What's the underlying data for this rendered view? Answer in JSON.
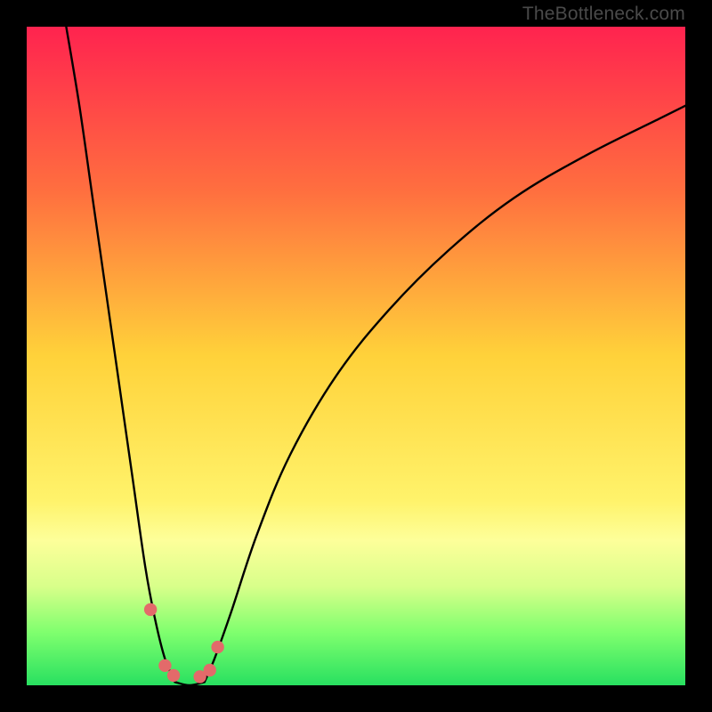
{
  "watermark": "TheBottleneck.com",
  "chart_data": {
    "type": "line",
    "title": "",
    "xlabel": "",
    "ylabel": "",
    "xlim": [
      0,
      100
    ],
    "ylim": [
      0,
      100
    ],
    "notes": "V-shaped bottleneck curve. Y-axis maps to background gradient: high=red (bottleneck), low=green (balanced). No numeric axes shown; x and y are relative 0–100.",
    "gradient_stops": [
      {
        "pct": 0,
        "color": "#ff234f"
      },
      {
        "pct": 25,
        "color": "#ff6f3f"
      },
      {
        "pct": 50,
        "color": "#ffd23a"
      },
      {
        "pct": 72,
        "color": "#fff36b"
      },
      {
        "pct": 78,
        "color": "#fdff9a"
      },
      {
        "pct": 85,
        "color": "#d8ff8a"
      },
      {
        "pct": 92,
        "color": "#7fff6e"
      },
      {
        "pct": 100,
        "color": "#28e060"
      }
    ],
    "series": [
      {
        "name": "left-branch",
        "x": [
          6,
          8,
          10,
          12,
          14,
          16,
          18,
          19.5,
          21,
          22.5
        ],
        "y": [
          100,
          88,
          74,
          60,
          46,
          32,
          18,
          10,
          4,
          0.5
        ]
      },
      {
        "name": "right-branch",
        "x": [
          27,
          28.5,
          31,
          35,
          40,
          47,
          55,
          64,
          74,
          85,
          96,
          100
        ],
        "y": [
          0.5,
          4,
          11,
          23,
          35,
          47,
          57,
          66,
          74,
          80.5,
          86,
          88
        ]
      },
      {
        "name": "valley-floor",
        "x": [
          22.5,
          24.7,
          27
        ],
        "y": [
          0.5,
          0,
          0.5
        ]
      }
    ],
    "markers": [
      {
        "x": 18.8,
        "y": 11.5
      },
      {
        "x": 21.0,
        "y": 3.0
      },
      {
        "x": 22.3,
        "y": 1.5
      },
      {
        "x": 26.3,
        "y": 1.3
      },
      {
        "x": 27.8,
        "y": 2.3
      },
      {
        "x": 29.0,
        "y": 5.8
      }
    ],
    "marker_color": "#e36a6a",
    "curve_color": "#000000"
  }
}
